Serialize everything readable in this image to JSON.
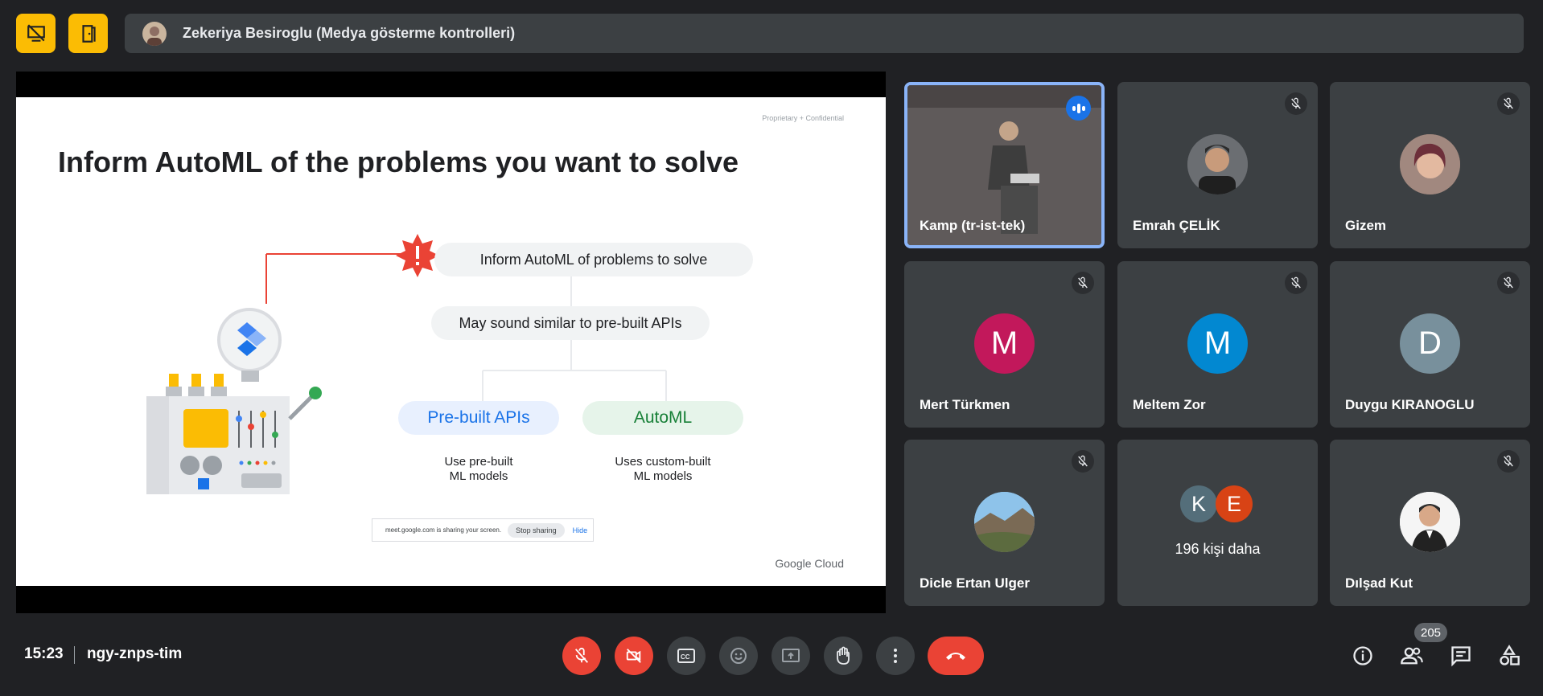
{
  "presenter_bar": {
    "text": "Zekeriya Besiroglu (Medya gösterme kontrolleri)"
  },
  "slide": {
    "confidential": "Proprietary + Confidential",
    "title": "Inform AutoML of the problems you want to solve",
    "step1": "Inform AutoML of problems to solve",
    "step2": "May sound similar to pre-built APIs",
    "option_left": "Pre-built APIs",
    "option_right": "AutoML",
    "caption_left_1": "Use pre-built",
    "caption_left_2": "ML models",
    "caption_right_1": "Uses custom-built",
    "caption_right_2": "ML models",
    "brand": "Google Cloud"
  },
  "share_banner": {
    "text": "meet.google.com is sharing your screen.",
    "stop": "Stop sharing",
    "hide": "Hide"
  },
  "participants": [
    {
      "name": "Kamp (tr-ist-tek)",
      "state": "speaking"
    },
    {
      "name": "Emrah ÇELİK",
      "state": "muted"
    },
    {
      "name": "Gizem",
      "state": "muted"
    },
    {
      "name": "Mert Türkmen",
      "initial": "M",
      "color": "#c2185b",
      "state": "muted"
    },
    {
      "name": "Meltem Zor",
      "initial": "M",
      "color": "#0288d1",
      "state": "muted"
    },
    {
      "name": "Duygu KIRANOGLU",
      "initial": "D",
      "color": "#78909c",
      "state": "muted"
    },
    {
      "name": "Dicle Ertan Ulger",
      "state": "muted"
    },
    {
      "name": "Dılşad Kut",
      "state": "muted"
    }
  ],
  "others": {
    "initial_1": "K",
    "initial_2": "E",
    "text": "196 kişi daha"
  },
  "bottom": {
    "time": "15:23",
    "meeting_code": "ngy-znps-tim",
    "people_count": "205"
  },
  "colors": {
    "accent_yellow": "#fbbc04",
    "danger_red": "#ea4335",
    "speaking_blue": "#1a73e8"
  }
}
